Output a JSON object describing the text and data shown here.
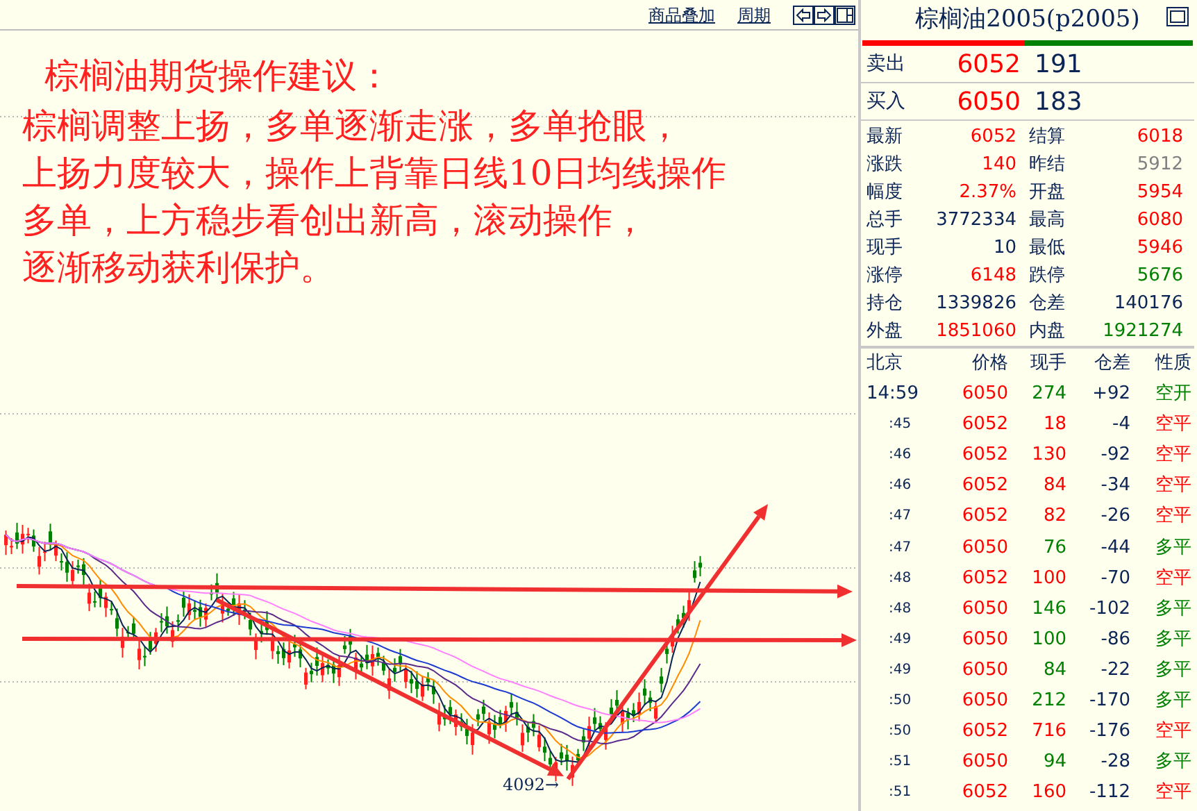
{
  "toolbar": {
    "links": [
      "商品叠加",
      "周期"
    ]
  },
  "note": {
    "title": "棕榈油期货操作建议：",
    "lines": [
      "棕榈调整上扬，多单逐渐走涨，多单抢眼，",
      "上扬力度较大，操作上背靠日线10日均线操作",
      "多单，上方稳步看创出新高，滚动操作，",
      "逐渐移动获利保护。"
    ]
  },
  "chart": {
    "low_label": "4092→"
  },
  "quote": {
    "title": "棕榈油2005(p2005)",
    "balance": {
      "level": 0.49
    },
    "orders": [
      {
        "label": "卖出",
        "price": "6052",
        "volume": "191"
      },
      {
        "label": "买入",
        "price": "6050",
        "volume": "183"
      }
    ],
    "stats": [
      {
        "label": "最新",
        "value": "6052",
        "color": "#ff0000"
      },
      {
        "label": "结算",
        "value": "6018",
        "color": "#ff0000"
      },
      {
        "label": "涨跌",
        "value": "140",
        "color": "#ff0000"
      },
      {
        "label": "昨结",
        "value": "5912",
        "color": "#808080"
      },
      {
        "label": "幅度",
        "value": "2.37%",
        "color": "#ff0000"
      },
      {
        "label": "开盘",
        "value": "5954",
        "color": "#ff0000"
      },
      {
        "label": "总手",
        "value": "3772334",
        "color": "#0a2456"
      },
      {
        "label": "最高",
        "value": "6080",
        "color": "#ff0000"
      },
      {
        "label": "现手",
        "value": "10",
        "color": "#0a2456"
      },
      {
        "label": "最低",
        "value": "5946",
        "color": "#ff0000"
      },
      {
        "label": "涨停",
        "value": "6148",
        "color": "#ff0000"
      },
      {
        "label": "跌停",
        "value": "5676",
        "color": "#008000"
      },
      {
        "label": "持仓",
        "value": "1339826",
        "color": "#0a2456"
      },
      {
        "label": "仓差",
        "value": "140176",
        "color": "#0a2456"
      },
      {
        "label": "外盘",
        "value": "1851060",
        "color": "#ff0000"
      },
      {
        "label": "内盘",
        "value": "1921274",
        "color": "#008000"
      }
    ],
    "ticks": {
      "columns": [
        "北京",
        "价格",
        "现手",
        "仓差",
        "性质"
      ],
      "rows": [
        {
          "time": "14:59",
          "price": "6050",
          "volume": "274",
          "oi_change": "+92",
          "nature": "空开",
          "color": "#008000"
        },
        {
          "time": ":45",
          "price": "6052",
          "volume": "18",
          "oi_change": "-4",
          "nature": "空平",
          "color": "#ff0000"
        },
        {
          "time": ":46",
          "price": "6052",
          "volume": "130",
          "oi_change": "-92",
          "nature": "空平",
          "color": "#ff0000"
        },
        {
          "time": ":46",
          "price": "6052",
          "volume": "84",
          "oi_change": "-34",
          "nature": "空平",
          "color": "#ff0000"
        },
        {
          "time": ":47",
          "price": "6052",
          "volume": "82",
          "oi_change": "-26",
          "nature": "空平",
          "color": "#ff0000"
        },
        {
          "time": ":47",
          "price": "6050",
          "volume": "76",
          "oi_change": "-44",
          "nature": "多平",
          "color": "#008000"
        },
        {
          "time": ":48",
          "price": "6052",
          "volume": "100",
          "oi_change": "-70",
          "nature": "空平",
          "color": "#ff0000"
        },
        {
          "time": ":48",
          "price": "6050",
          "volume": "146",
          "oi_change": "-102",
          "nature": "多平",
          "color": "#008000"
        },
        {
          "time": ":49",
          "price": "6050",
          "volume": "100",
          "oi_change": "-86",
          "nature": "多平",
          "color": "#008000"
        },
        {
          "time": ":49",
          "price": "6050",
          "volume": "84",
          "oi_change": "-22",
          "nature": "多平",
          "color": "#008000"
        },
        {
          "time": ":50",
          "price": "6050",
          "volume": "212",
          "oi_change": "-170",
          "nature": "多平",
          "color": "#008000"
        },
        {
          "time": ":50",
          "price": "6052",
          "volume": "716",
          "oi_change": "-176",
          "nature": "空平",
          "color": "#ff0000"
        },
        {
          "time": ":51",
          "price": "6050",
          "volume": "94",
          "oi_change": "-28",
          "nature": "多平",
          "color": "#008000"
        },
        {
          "time": ":51",
          "price": "6052",
          "volume": "160",
          "oi_change": "-112",
          "nature": "空平",
          "color": "#ff0000"
        }
      ]
    }
  }
}
